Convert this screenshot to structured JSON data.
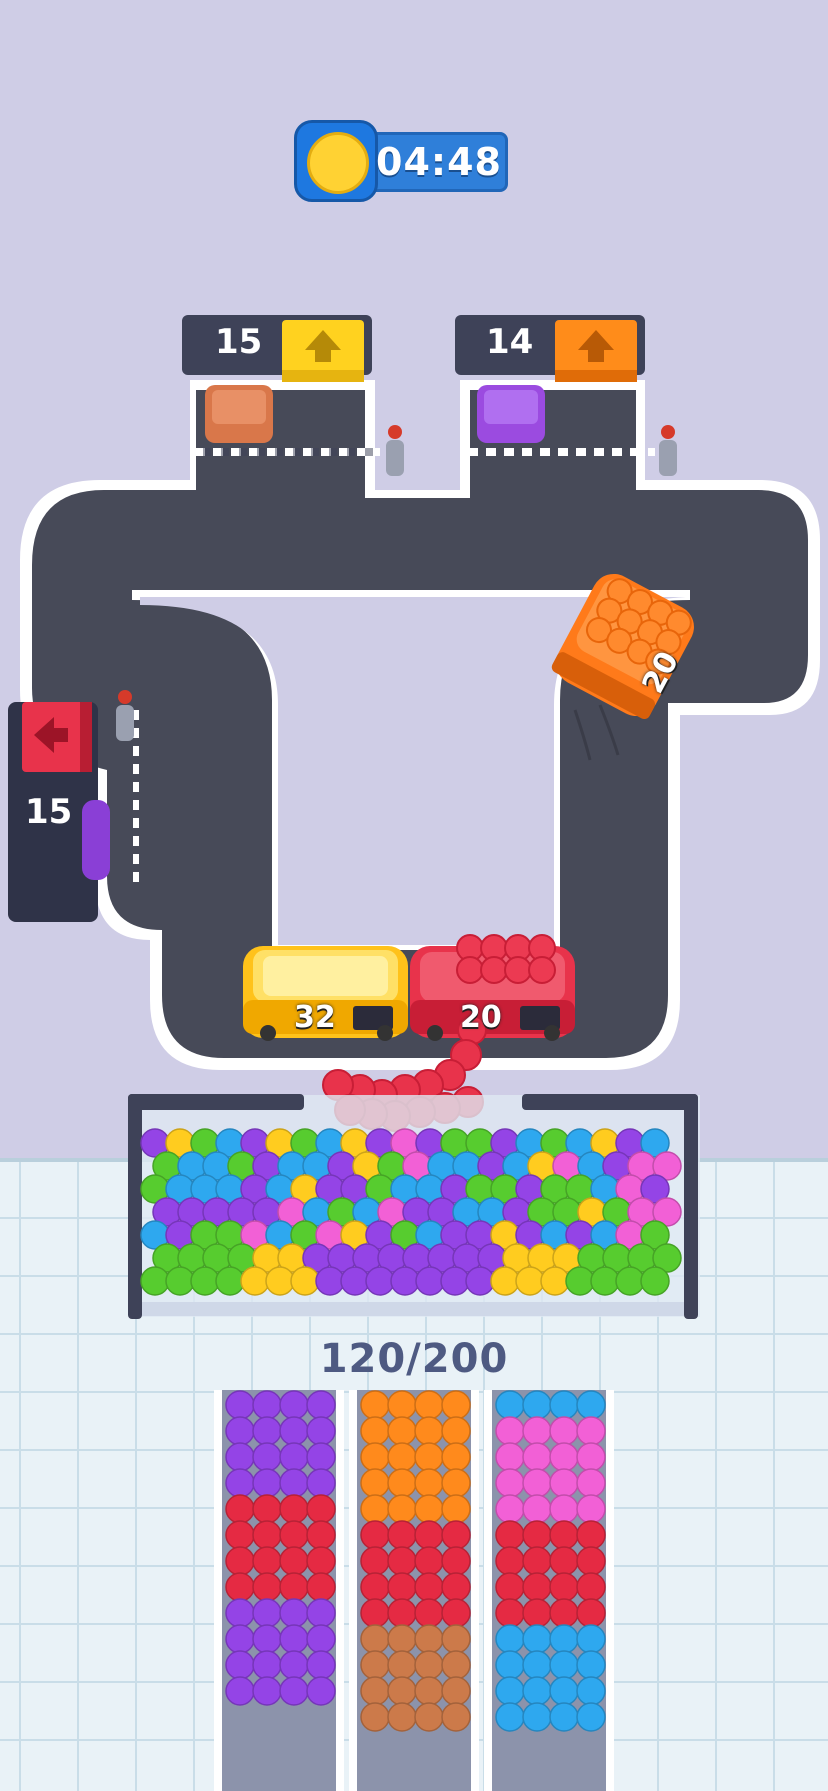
{
  "timer": {
    "text": "04:48",
    "icon": "alarm-clock-icon"
  },
  "parking_gates": [
    {
      "count": "15",
      "arrow": "up-arrow-icon",
      "color": "#ffd21f",
      "car_color": "#d9774a"
    },
    {
      "count": "14",
      "arrow": "up-arrow-icon",
      "color": "#ff8c1a",
      "car_color": "#9b4be0"
    },
    {
      "count": "15",
      "arrow": "left-arrow-icon",
      "color": "#e8334b",
      "car_color": "#8a3fd6"
    }
  ],
  "buses": [
    {
      "label": "20",
      "color": "#ff7a1a"
    },
    {
      "label": "32",
      "color": "#ffc21a"
    },
    {
      "label": "20",
      "color": "#e8334b"
    }
  ],
  "queue_counter": "120/200",
  "colors": {
    "background_top": "#cfcde6",
    "floor": "#e9f2f7",
    "road": "#474a58",
    "purple": "#9444e6",
    "red": "#e52a43",
    "orange": "#ff8a1c",
    "pink": "#f260d6",
    "blue": "#2ea8ef",
    "green": "#57cc2f",
    "yellow": "#ffcc1f",
    "brown": "#cc7a4a"
  },
  "columns": [
    [
      "purple",
      "purple",
      "purple",
      "purple",
      "red",
      "red",
      "red",
      "red",
      "purple",
      "purple",
      "purple",
      "purple"
    ],
    [
      "orange",
      "orange",
      "orange",
      "orange",
      "orange",
      "red",
      "red",
      "red",
      "red",
      "brown",
      "brown",
      "brown",
      "brown"
    ],
    [
      "blue",
      "pink",
      "pink",
      "pink",
      "pink",
      "red",
      "red",
      "red",
      "red",
      "blue",
      "blue",
      "blue",
      "blue"
    ]
  ]
}
